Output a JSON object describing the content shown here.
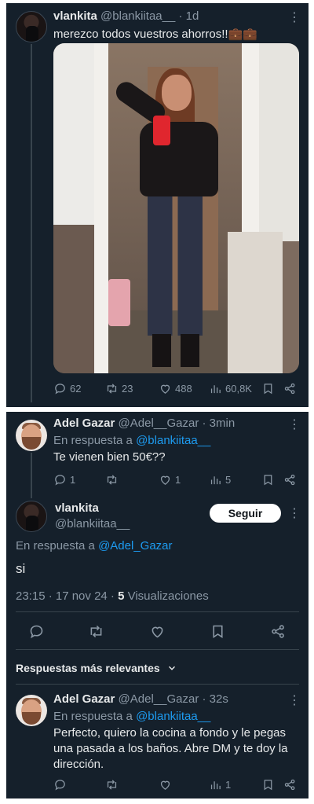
{
  "tweet1": {
    "name": "vlankita",
    "handle": "@blankiitaa__",
    "time": "· 1d",
    "text": "merezco todos vuestros ahorros!!",
    "emoji": "💼💼",
    "stats": {
      "replies": "62",
      "retweets": "23",
      "likes": "488",
      "views": "60,8K"
    }
  },
  "reply1": {
    "name": "Adel Gazar",
    "handle": "@Adel__Gazar",
    "time": "· 3min",
    "in_reply_prefix": "En respuesta a",
    "in_reply_handle": "@blankiitaa__",
    "text": "Te vienen bien 50€??",
    "stats": {
      "replies": "1",
      "likes": "1",
      "views": "5"
    }
  },
  "main": {
    "name": "vlankita",
    "handle": "@blankiitaa__",
    "follow_label": "Seguir",
    "in_reply_prefix": "En respuesta a",
    "in_reply_handle": "@Adel_Gazar",
    "text": "si",
    "timestamp": "23:15 · 17 nov 24 ·",
    "views_count": "5",
    "views_label": "Visualizaciones"
  },
  "replies_header": "Respuestas más relevantes",
  "reply2": {
    "name": "Adel Gazar",
    "handle": "@Adel__Gazar",
    "time": "· 32s",
    "in_reply_prefix": "En respuesta a",
    "in_reply_handle": "@blankiitaa__",
    "text_lines": [
      "Perfecto, quiero la cocina a fondo y le pegas",
      "una pasada a los baños. Abre DM y te doy la",
      "dirección."
    ],
    "stats": {
      "views": "1"
    }
  },
  "icons": [
    "reply-icon",
    "retweet-icon",
    "like-icon",
    "views-icon",
    "bookmark-icon",
    "share-icon",
    "more-icon",
    "chevron-down-icon"
  ],
  "colors": {
    "background": "#15202b",
    "text": "#e7e9ea",
    "muted": "#8b98a5",
    "link": "#1d9bf0",
    "divider": "#38444d"
  }
}
